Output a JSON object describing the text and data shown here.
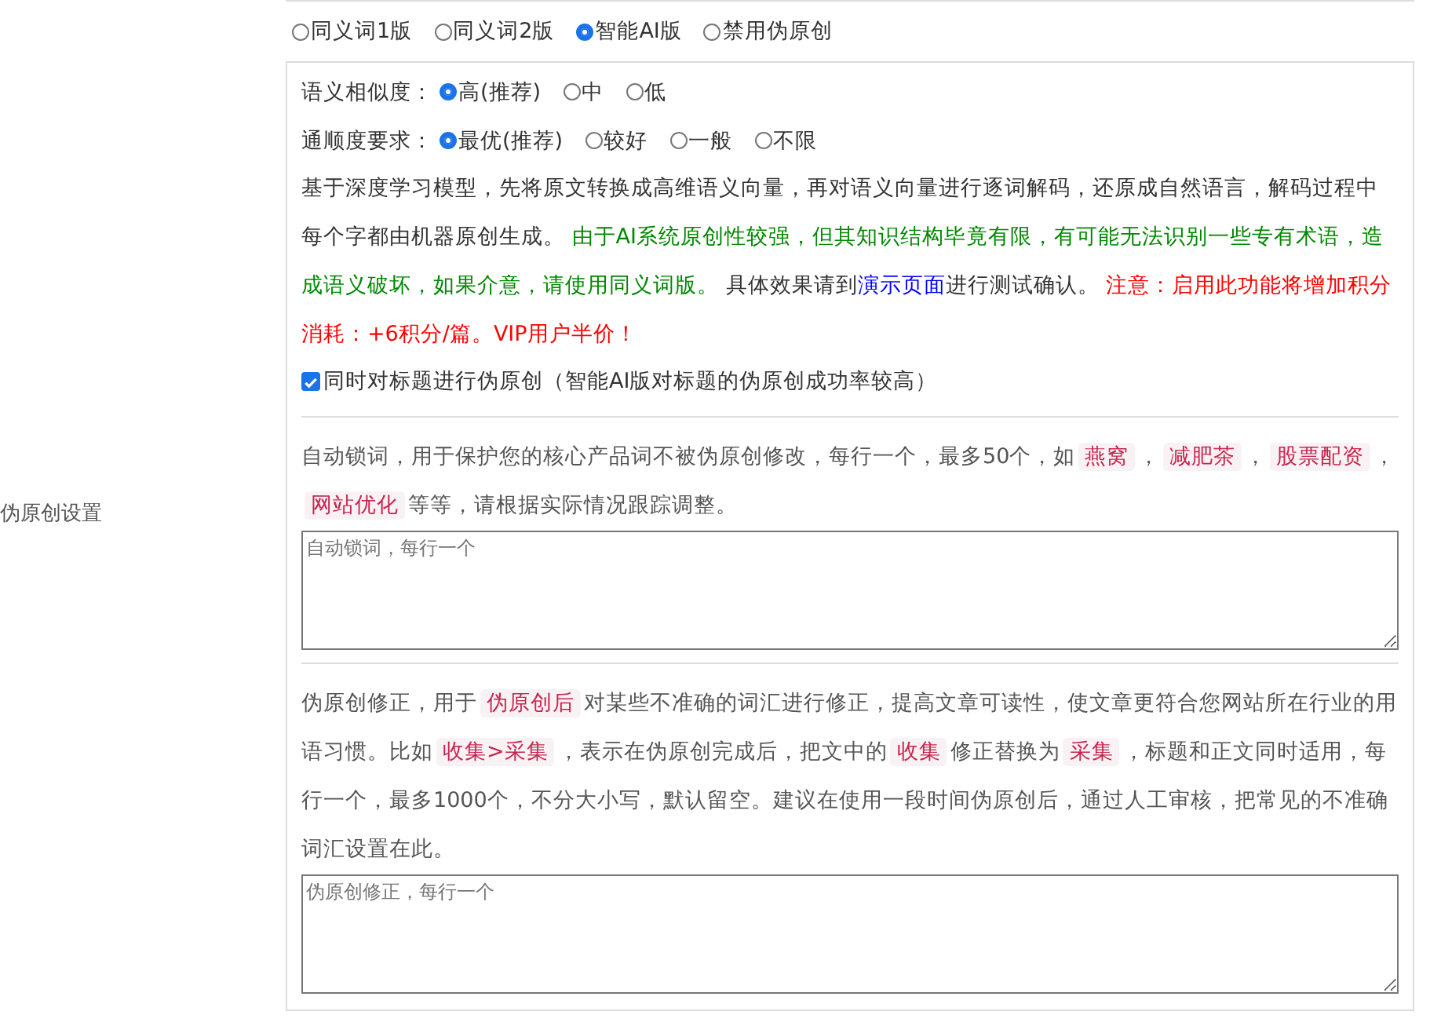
{
  "side_label": "伪原创设置",
  "modes": [
    {
      "label": "同义词1版",
      "selected": false
    },
    {
      "label": "同义词2版",
      "selected": false
    },
    {
      "label": "智能AI版",
      "selected": true
    },
    {
      "label": "禁用伪原创",
      "selected": false
    }
  ],
  "option_groups": [
    {
      "label": "语义相似度：",
      "options": [
        {
          "label": "高(推荐)",
          "selected": true
        },
        {
          "label": "中",
          "selected": false
        },
        {
          "label": "低",
          "selected": false
        }
      ]
    },
    {
      "label": "通顺度要求：",
      "options": [
        {
          "label": "最优(推荐)",
          "selected": true
        },
        {
          "label": "较好",
          "selected": false
        },
        {
          "label": "一般",
          "selected": false
        },
        {
          "label": "不限",
          "selected": false
        }
      ]
    }
  ],
  "description": [
    {
      "kind": "plain",
      "text": "基于深度学习模型，先将原文转换成高维语义向量，再对语义向量进行逐词解码，还原成自然语言，解码过程中每个字都由机器原创生成。 "
    },
    {
      "kind": "notice",
      "text": "由于AI系统原创性较强，但其知识结构毕竟有限，有可能无法识别一些专有术语，造成语义破坏，如果介意，请使用同义词版。"
    },
    {
      "kind": "plain",
      "text": " 具体效果请到"
    },
    {
      "kind": "link",
      "text": "演示页面"
    },
    {
      "kind": "plain",
      "text": "进行测试确认。 "
    },
    {
      "kind": "warning",
      "text": "注意：启用此功能将增加积分消耗：+6积分/篇。VIP用户半价！"
    }
  ],
  "title_option": {
    "label": "同时对标题进行伪原创（智能AI版对标题的伪原创成功率较高）",
    "checked": true
  },
  "lock_words": {
    "text": [
      {
        "kind": "plain",
        "text": "自动锁词，用于保护您的核心产品词不被伪原创修改，每行一个，最多50个，如"
      },
      {
        "kind": "tag",
        "text": "燕窝"
      },
      {
        "kind": "plain",
        "text": "，"
      },
      {
        "kind": "tag",
        "text": "减肥茶"
      },
      {
        "kind": "plain",
        "text": "，"
      },
      {
        "kind": "tag",
        "text": "股票配资"
      },
      {
        "kind": "plain",
        "text": "，"
      },
      {
        "kind": "tag",
        "text": "网站优化"
      },
      {
        "kind": "plain",
        "text": "等等，请根据实际情况跟踪调整。"
      }
    ],
    "placeholder": "自动锁词，每行一个"
  },
  "corrections": {
    "text": [
      {
        "kind": "plain",
        "text": "伪原创修正，用于"
      },
      {
        "kind": "tag",
        "text": "伪原创后"
      },
      {
        "kind": "plain",
        "text": "对某些不准确的词汇进行修正，提高文章可读性，使文章更符合您网站所在行业的用语习惯。比如"
      },
      {
        "kind": "tag",
        "text": "收集>采集"
      },
      {
        "kind": "plain",
        "text": "，表示在伪原创完成后，把文中的"
      },
      {
        "kind": "tag",
        "text": "收集"
      },
      {
        "kind": "plain",
        "text": "修正替换为"
      },
      {
        "kind": "tag",
        "text": "采集"
      },
      {
        "kind": "plain",
        "text": "，标题和正文同时适用，每行一个，最多1000个，不分大小写，默认留空。建议在使用一段时间伪原创后，通过人工审核，把常见的不准确词汇设置在此。"
      }
    ],
    "placeholder": "伪原创修正，每行一个"
  }
}
